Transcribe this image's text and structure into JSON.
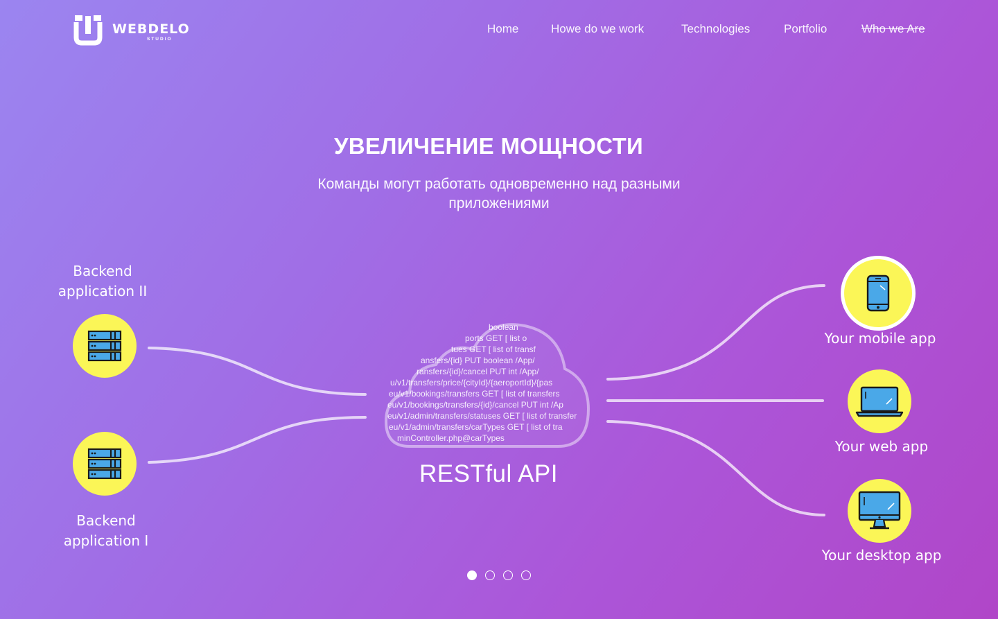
{
  "brand": {
    "name": "WEBDELO",
    "sub": "STUDIO"
  },
  "nav": {
    "items": [
      {
        "label": "Home"
      },
      {
        "label": "Howe do we work"
      },
      {
        "label": "Technologies"
      },
      {
        "label": "Portfolio"
      },
      {
        "label": "Who we Are",
        "struck": true
      }
    ]
  },
  "hero": {
    "title": "УВЕЛИЧЕНИЕ МОЩНОСТИ",
    "subtitle": "Команды могут работать одновременно над разными приложениями"
  },
  "diagram": {
    "backend_top": {
      "label": "Backend application II",
      "icon": "server-icon"
    },
    "backend_bottom": {
      "label": "Backend application I",
      "icon": "server-icon"
    },
    "center": {
      "label": "RESTful API",
      "icon": "cloud-icon"
    },
    "clients": [
      {
        "label": "Your mobile app",
        "icon": "smartphone-icon"
      },
      {
        "label": "Your web app",
        "icon": "laptop-icon"
      },
      {
        "label": "Your desktop app",
        "icon": "desktop-monitor-icon"
      }
    ],
    "cloud_code_lines": [
      "boolean",
      "ports   GET   [ list o",
      "tues   GET   [ list of transf",
      "ansfers/{id}   PUT   boolean   /App/",
      "ransfers/{id}/cancel   PUT   int   /App/",
      "u/v1/transfers/price/{cityId}/{aeroportId}/{pas",
      "eu/v1/bookings/transfers   GET   [ list of transfers",
      "eu/v1/bookings/transfers/{id}/cancel   PUT   int   /Ap",
      "eu/v1/admin/transfers/statuses   GET  [ list of transfer",
      "eu/v1/admin/transfers/carTypes   GET   [ list of tra",
      "minController.php@carTypes"
    ]
  },
  "pager": {
    "count": 4,
    "active_index": 0
  },
  "colors": {
    "accent_yellow": "#fbf657",
    "icon_blue": "#4aa8e8",
    "background_start": "#9b85f0",
    "background_end": "#b046c8"
  }
}
